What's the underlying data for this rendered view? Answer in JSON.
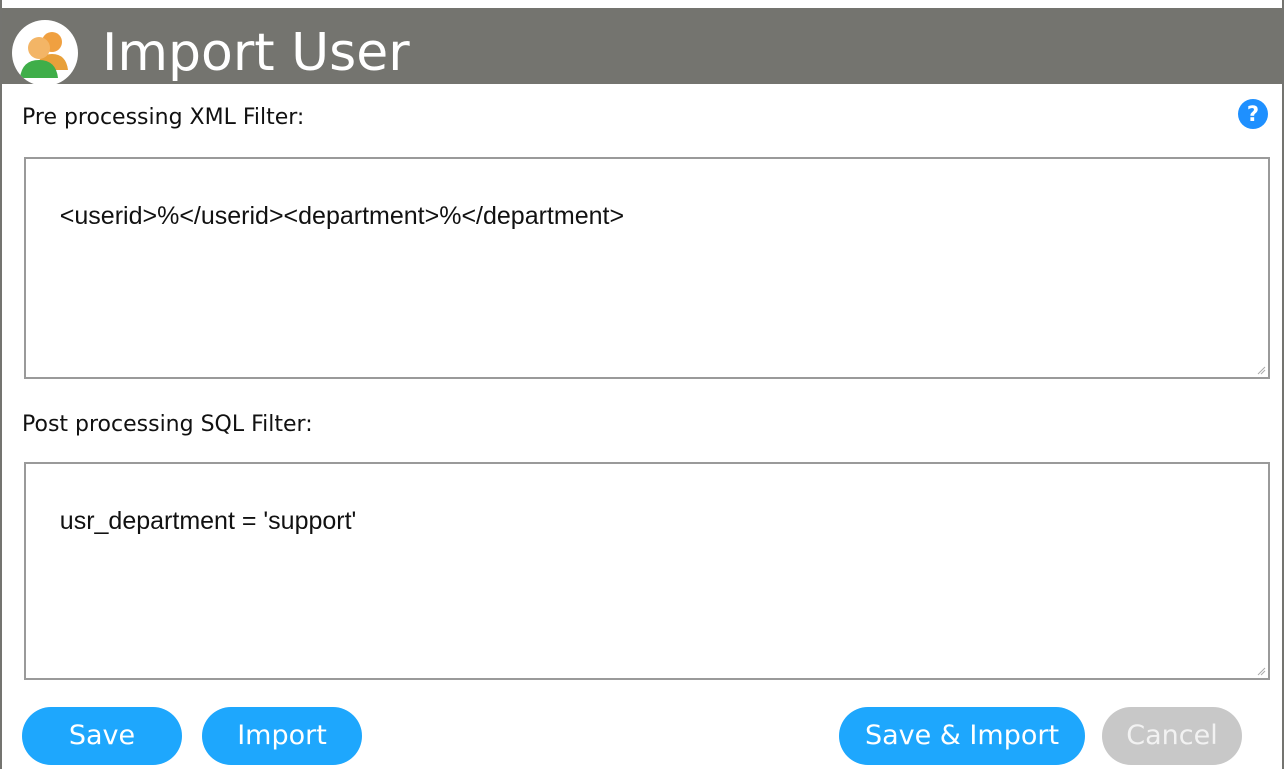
{
  "window": {
    "title": "Import User",
    "icon": "users-icon"
  },
  "help": {
    "glyph": "?",
    "icon": "help-icon",
    "color": "#1e90ff"
  },
  "pre_filter": {
    "label": "Pre processing XML Filter:",
    "value": "<userid>%</userid><department>%</department>"
  },
  "post_filter": {
    "label": "Post processing SQL Filter:",
    "value": "usr_department = 'support'"
  },
  "buttons": {
    "save": "Save",
    "import": "Import",
    "save_import": "Save & Import",
    "cancel": "Cancel"
  },
  "colors": {
    "titlebar": "#74746f",
    "button": "#1ea7fd",
    "button_disabled": "#c8c8c8"
  }
}
